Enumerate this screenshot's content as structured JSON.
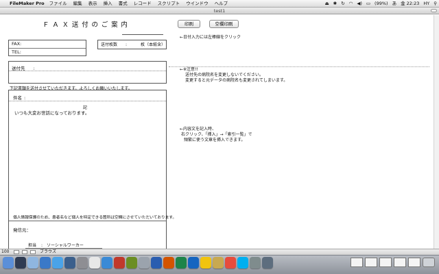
{
  "menubar": {
    "apple_glyph": "",
    "app_name": "FileMaker Pro",
    "items": [
      "ファイル",
      "編集",
      "表示",
      "挿入",
      "書式",
      "レコード",
      "スクリプト",
      "ウインドウ",
      "ヘルプ"
    ],
    "battery": "(99%)",
    "clock": "金 22:23",
    "user": "HY"
  },
  "window": {
    "title": "test1"
  },
  "form": {
    "title": "ＦＡＸ送付のご案内",
    "fax_label": "FAX:",
    "tel_label": "TEL:",
    "pages_label": "送付枚数",
    "pages_sep": ":",
    "pages_unit": "枚（本紙含）",
    "recipient_label": "送付先",
    "recipient_sep": ":",
    "notice": "下記書類を送付させていただきます。よろしくお願いいたします。",
    "subject_label": "件名",
    "subject_sep": ":",
    "ki": "記",
    "greeting": "いつも大変お世話になっております。",
    "privacy": "個人情報保護のため、患者名など個人を特定できる箇所は空欄にさせていただいております。",
    "sender_label": "発信元：",
    "contact_label": "担当",
    "contact_sep": ":",
    "contact_role": "ソーシャルワーカー"
  },
  "buttons": {
    "print": "印刷",
    "blank_print": "空欄印刷"
  },
  "notes": {
    "date": "←日付入力には左棒線をクリック",
    "caution": [
      "←※注意!!",
      "送付先の病院名を変更しないでください。",
      "変更すると元データの病院名も変更されてしまいます。"
    ],
    "body": [
      "←内容文を記入時、",
      "右クリック、「挿入」→「索引一覧」で",
      "頻繁に使う文章を挿入できます。"
    ]
  },
  "statusbar": {
    "zoom": "100",
    "mode": "ブラウズ"
  },
  "dock": {
    "icon_names": [
      "finder-icon",
      "dashboard-icon",
      "mail-icon",
      "safari-icon",
      "app-store-icon",
      "time-machine-icon",
      "system-preferences-icon",
      "ical-icon",
      "itunes-icon",
      "photo-booth-icon",
      "iphoto-icon",
      "preview-icon",
      "word-icon",
      "powerpoint-icon",
      "excel-icon",
      "outlook-icon",
      "messenger-icon",
      "network-icon",
      "chrome-icon",
      "skype-icon",
      "filemaker-icon",
      "utilities-icon"
    ],
    "icon_colors": [
      "#5b8fd8",
      "#2f3b52",
      "#8fb6e0",
      "#3a79c8",
      "#4aa3e8",
      "#3b5f8c",
      "#8e8e93",
      "#e8e8e8",
      "#3a8ad6",
      "#c0392b",
      "#6b8e23",
      "#9ba3ad",
      "#2a5db0",
      "#d35400",
      "#1e8449",
      "#1565c0",
      "#f1c40f",
      "#c8a951",
      "#e74c3c",
      "#00aff0",
      "#7f8c8d",
      "#5d6d7e"
    ]
  }
}
